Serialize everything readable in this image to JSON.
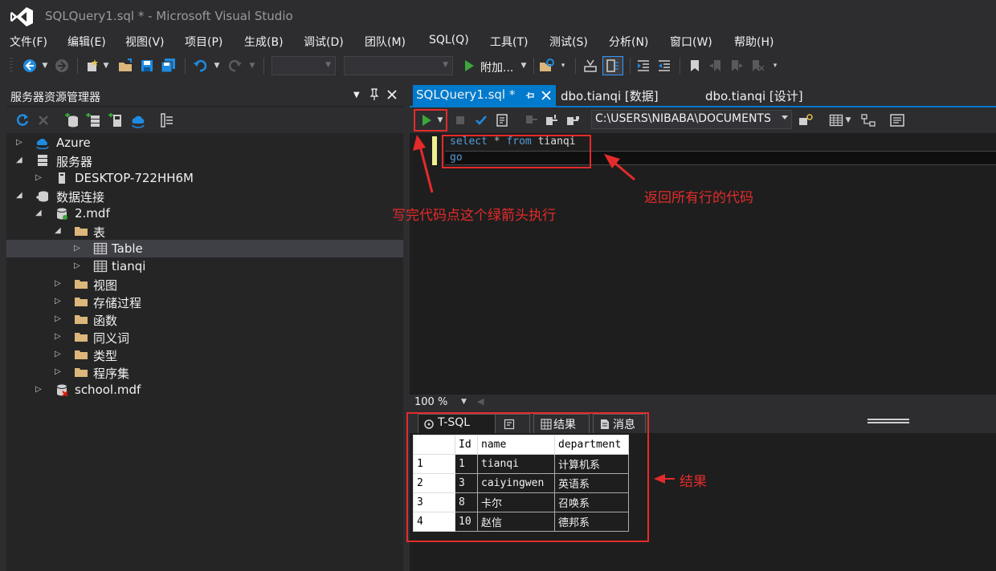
{
  "window": {
    "title": "SQLQuery1.sql * - Microsoft Visual Studio"
  },
  "menu": [
    "文件(F)",
    "编辑(E)",
    "视图(V)",
    "项目(P)",
    "生成(B)",
    "调试(D)",
    "团队(M)",
    "SQL(Q)",
    "工具(T)",
    "测试(S)",
    "分析(N)",
    "窗口(W)",
    "帮助(H)"
  ],
  "toolbar": {
    "attach_label": "附加...",
    "solution_config_value": "",
    "solution_platform_value": ""
  },
  "server_explorer": {
    "title": "服务器资源管理器",
    "tree": [
      {
        "label": "Azure",
        "icon": "azure-cloud-icon",
        "expanded": false
      },
      {
        "label": "服务器",
        "icon": "servers-icon",
        "expanded": true
      },
      {
        "label": "DESKTOP-722HH6M",
        "icon": "computer-icon",
        "expanded": false
      },
      {
        "label": "数据连接",
        "icon": "data-connections-icon",
        "expanded": true
      },
      {
        "label": "2.mdf",
        "icon": "database-icon",
        "expanded": true
      },
      {
        "label": "表",
        "icon": "folder-icon",
        "expanded": true
      },
      {
        "label": "Table",
        "icon": "table-icon",
        "expanded": false,
        "selected": true
      },
      {
        "label": "tianqi",
        "icon": "table-icon",
        "expanded": false
      },
      {
        "label": "视图",
        "icon": "folder-icon",
        "expanded": false
      },
      {
        "label": "存储过程",
        "icon": "folder-icon",
        "expanded": false
      },
      {
        "label": "函数",
        "icon": "folder-icon",
        "expanded": false
      },
      {
        "label": "同义词",
        "icon": "folder-icon",
        "expanded": false
      },
      {
        "label": "类型",
        "icon": "folder-icon",
        "expanded": false
      },
      {
        "label": "程序集",
        "icon": "folder-icon",
        "expanded": false
      },
      {
        "label": "school.mdf",
        "icon": "database-disconnected-icon",
        "expanded": false
      }
    ]
  },
  "tabs": [
    {
      "label": "SQLQuery1.sql *",
      "active": true
    },
    {
      "label": "dbo.tianqi [数据]",
      "active": false
    },
    {
      "label": "dbo.tianqi [设计]",
      "active": false
    }
  ],
  "editor": {
    "connection": "C:\\USERS\\NIBABA\\DOCUMENTS",
    "line1": {
      "kw1": "select",
      "op": " * ",
      "kw2": "from",
      "rest": " tianqi"
    },
    "line2": "go",
    "zoom": "100 %"
  },
  "results": {
    "tabs": [
      "T-SQL",
      "结果",
      "消息"
    ],
    "columns": [
      "Id",
      "name",
      "department"
    ],
    "rows": [
      [
        "1",
        "1",
        "tianqi",
        "计算机系"
      ],
      [
        "2",
        "3",
        "caiyingwen",
        "英语系"
      ],
      [
        "3",
        "8",
        "卡尔",
        "召唤系"
      ],
      [
        "4",
        "10",
        "赵信",
        "德邦系"
      ]
    ]
  },
  "annotations": {
    "run_hint": "写完代码点这个绿箭头执行",
    "code_hint": "返回所有行的代码",
    "result_hint": "结果"
  },
  "colors": {
    "accent": "#007acc",
    "annotation": "#e42b2b",
    "run_green": "#3ca63c",
    "keyword": "#569cd6"
  }
}
